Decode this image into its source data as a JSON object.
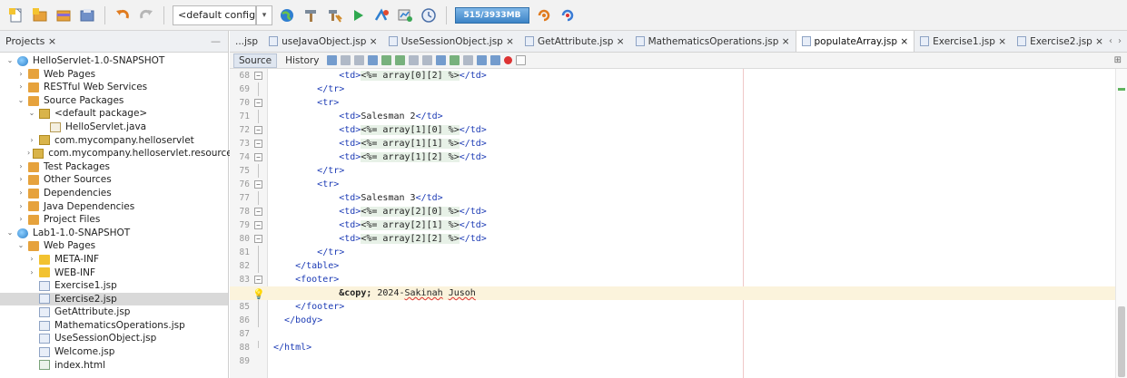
{
  "toolbar": {
    "config": "<default config>",
    "memory": "515/3933MB",
    "icons": [
      "new-file-icon",
      "new-project-icon",
      "open-project-icon",
      "close-project-icon",
      "undo-icon",
      "redo-icon",
      "config-dropdown",
      "globe-icon",
      "hammer-icon",
      "clean-build-icon",
      "run-icon",
      "debug-icon",
      "profile-icon",
      "history-icon",
      "gc-icon",
      "gc2-icon"
    ]
  },
  "projects": {
    "tab_label": "Projects ×",
    "tree": [
      {
        "label": "HelloServlet-1.0-SNAPSHOT",
        "depth": 0,
        "chev": "⌄",
        "icon": "globe"
      },
      {
        "label": "Web Pages",
        "depth": 1,
        "chev": "›",
        "icon": "folder-o"
      },
      {
        "label": "RESTful Web Services",
        "depth": 1,
        "chev": "›",
        "icon": "folder-o"
      },
      {
        "label": "Source Packages",
        "depth": 1,
        "chev": "⌄",
        "icon": "folder-o"
      },
      {
        "label": "<default package>",
        "depth": 2,
        "chev": "⌄",
        "icon": "pkg"
      },
      {
        "label": "HelloServlet.java",
        "depth": 3,
        "chev": "",
        "icon": "java"
      },
      {
        "label": "com.mycompany.helloservlet",
        "depth": 2,
        "chev": "›",
        "icon": "pkg"
      },
      {
        "label": "com.mycompany.helloservlet.resources",
        "depth": 2,
        "chev": "›",
        "icon": "pkg"
      },
      {
        "label": "Test Packages",
        "depth": 1,
        "chev": "›",
        "icon": "folder-o"
      },
      {
        "label": "Other Sources",
        "depth": 1,
        "chev": "›",
        "icon": "folder-o"
      },
      {
        "label": "Dependencies",
        "depth": 1,
        "chev": "›",
        "icon": "folder-o"
      },
      {
        "label": "Java Dependencies",
        "depth": 1,
        "chev": "›",
        "icon": "folder-o"
      },
      {
        "label": "Project Files",
        "depth": 1,
        "chev": "›",
        "icon": "folder-o"
      },
      {
        "label": "Lab1-1.0-SNAPSHOT",
        "depth": 0,
        "chev": "⌄",
        "icon": "globe"
      },
      {
        "label": "Web Pages",
        "depth": 1,
        "chev": "⌄",
        "icon": "folder-o"
      },
      {
        "label": "META-INF",
        "depth": 2,
        "chev": "›",
        "icon": "folder-y"
      },
      {
        "label": "WEB-INF",
        "depth": 2,
        "chev": "›",
        "icon": "folder-y"
      },
      {
        "label": "Exercise1.jsp",
        "depth": 2,
        "chev": "",
        "icon": "file"
      },
      {
        "label": "Exercise2.jsp",
        "depth": 2,
        "chev": "",
        "icon": "file",
        "selected": true
      },
      {
        "label": "GetAttribute.jsp",
        "depth": 2,
        "chev": "",
        "icon": "file"
      },
      {
        "label": "MathematicsOperations.jsp",
        "depth": 2,
        "chev": "",
        "icon": "file"
      },
      {
        "label": "UseSessionObject.jsp",
        "depth": 2,
        "chev": "",
        "icon": "file"
      },
      {
        "label": "Welcome.jsp",
        "depth": 2,
        "chev": "",
        "icon": "file"
      },
      {
        "label": "index.html",
        "depth": 2,
        "chev": "",
        "icon": "html"
      }
    ]
  },
  "editor": {
    "tabs": [
      {
        "label": "...jsp",
        "active": false,
        "icon": false
      },
      {
        "label": "useJavaObject.jsp ×",
        "active": false,
        "icon": true
      },
      {
        "label": "UseSessionObject.jsp ×",
        "active": false,
        "icon": true
      },
      {
        "label": "GetAttribute.jsp ×",
        "active": false,
        "icon": true
      },
      {
        "label": "MathematicsOperations.jsp ×",
        "active": false,
        "icon": true
      },
      {
        "label": "populateArray.jsp ×",
        "active": true,
        "icon": true
      },
      {
        "label": "Exercise1.jsp ×",
        "active": false,
        "icon": true
      },
      {
        "label": "Exercise2.jsp ×",
        "active": false,
        "icon": true
      }
    ],
    "modes": {
      "source": "Source",
      "history": "History"
    },
    "lines": [
      {
        "n": "68",
        "fold": "box",
        "segs": [
          [
            "txt",
            "            "
          ],
          [
            "tag",
            "<td>"
          ],
          [
            "jsp",
            "<%= array[0][2] %>"
          ],
          [
            "tag",
            "</td>"
          ]
        ]
      },
      {
        "n": "69",
        "fold": "line",
        "segs": [
          [
            "txt",
            "        "
          ],
          [
            "tag",
            "</tr>"
          ]
        ]
      },
      {
        "n": "70",
        "fold": "box",
        "segs": [
          [
            "txt",
            "        "
          ],
          [
            "tag",
            "<tr>"
          ]
        ]
      },
      {
        "n": "71",
        "fold": "line",
        "segs": [
          [
            "txt",
            "            "
          ],
          [
            "tag",
            "<td>"
          ],
          [
            "txt",
            "Salesman 2"
          ],
          [
            "tag",
            "</td>"
          ]
        ]
      },
      {
        "n": "72",
        "fold": "box",
        "segs": [
          [
            "txt",
            "            "
          ],
          [
            "tag",
            "<td>"
          ],
          [
            "jsp",
            "<%= array[1][0] %>"
          ],
          [
            "tag",
            "</td>"
          ]
        ]
      },
      {
        "n": "73",
        "fold": "box",
        "segs": [
          [
            "txt",
            "            "
          ],
          [
            "tag",
            "<td>"
          ],
          [
            "jsp",
            "<%= array[1][1] %>"
          ],
          [
            "tag",
            "</td>"
          ]
        ]
      },
      {
        "n": "74",
        "fold": "box",
        "segs": [
          [
            "txt",
            "            "
          ],
          [
            "tag",
            "<td>"
          ],
          [
            "jsp",
            "<%= array[1][2] %>"
          ],
          [
            "tag",
            "</td>"
          ]
        ]
      },
      {
        "n": "75",
        "fold": "line",
        "segs": [
          [
            "txt",
            "        "
          ],
          [
            "tag",
            "</tr>"
          ]
        ]
      },
      {
        "n": "76",
        "fold": "box",
        "segs": [
          [
            "txt",
            "        "
          ],
          [
            "tag",
            "<tr>"
          ]
        ]
      },
      {
        "n": "77",
        "fold": "line",
        "segs": [
          [
            "txt",
            "            "
          ],
          [
            "tag",
            "<td>"
          ],
          [
            "txt",
            "Salesman 3"
          ],
          [
            "tag",
            "</td>"
          ]
        ]
      },
      {
        "n": "78",
        "fold": "box",
        "segs": [
          [
            "txt",
            "            "
          ],
          [
            "tag",
            "<td>"
          ],
          [
            "jsp",
            "<%= array[2][0] %>"
          ],
          [
            "tag",
            "</td>"
          ]
        ]
      },
      {
        "n": "79",
        "fold": "box",
        "segs": [
          [
            "txt",
            "            "
          ],
          [
            "tag",
            "<td>"
          ],
          [
            "jsp",
            "<%= array[2][1] %>"
          ],
          [
            "tag",
            "</td>"
          ]
        ]
      },
      {
        "n": "80",
        "fold": "box",
        "segs": [
          [
            "txt",
            "            "
          ],
          [
            "tag",
            "<td>"
          ],
          [
            "jsp",
            "<%= array[2][2] %>"
          ],
          [
            "tag",
            "</td>"
          ]
        ]
      },
      {
        "n": "81",
        "fold": "line",
        "segs": [
          [
            "txt",
            "        "
          ],
          [
            "tag",
            "</tr>"
          ]
        ]
      },
      {
        "n": "82",
        "fold": "line",
        "segs": [
          [
            "txt",
            "    "
          ],
          [
            "tag",
            "</table>"
          ]
        ]
      },
      {
        "n": "83",
        "fold": "box",
        "segs": [
          [
            "txt",
            "    "
          ],
          [
            "tag",
            "<footer>"
          ]
        ]
      },
      {
        "n": "",
        "fold": "bulb",
        "hl": true,
        "segs": [
          [
            "txt",
            "            "
          ],
          [
            "ent",
            "&copy;"
          ],
          [
            "txt",
            " 2024-"
          ],
          [
            "sq",
            "Sakinah"
          ],
          [
            "txt",
            " "
          ],
          [
            "sq",
            "Jusoh"
          ]
        ]
      },
      {
        "n": "85",
        "fold": "line",
        "segs": [
          [
            "txt",
            "    "
          ],
          [
            "tag",
            "</footer>"
          ]
        ]
      },
      {
        "n": "86",
        "fold": "line",
        "segs": [
          [
            "txt",
            "  "
          ],
          [
            "tag",
            "</body>"
          ]
        ]
      },
      {
        "n": "87",
        "fold": "",
        "segs": []
      },
      {
        "n": "88",
        "fold": "end",
        "segs": [
          [
            "tag",
            "</html>"
          ]
        ]
      },
      {
        "n": "89",
        "fold": "",
        "segs": []
      }
    ]
  }
}
